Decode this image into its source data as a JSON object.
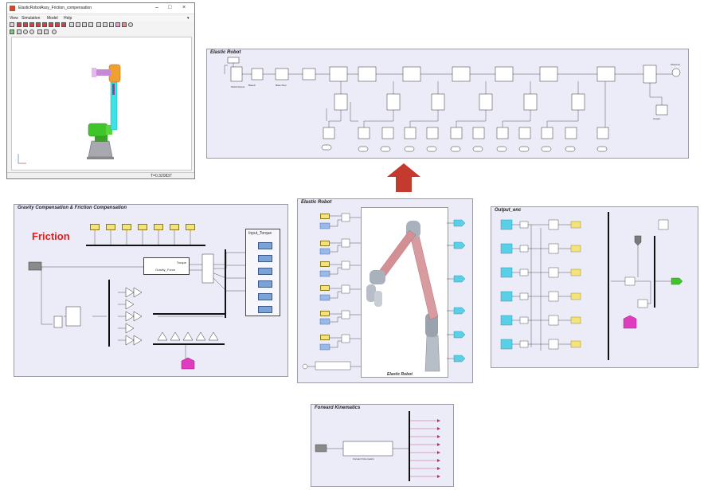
{
  "window": {
    "title": "ElasticRobotAssy_Friction_compensation",
    "menu": [
      "View",
      "Simulation",
      "Model",
      "Help"
    ],
    "status_time": "T=0.320837"
  },
  "panels": {
    "elastic_top": {
      "title": "Elastic Robot"
    },
    "gravity": {
      "title": "Gravity Compensation & Friction Compensation",
      "label": "Friction",
      "input_torque": "Input_Torque",
      "gravity_torque": "Torque",
      "gravity_force": "Gravity_Force"
    },
    "elastic_mid": {
      "title": "Elastic Robot",
      "caption": "Elastic Robot"
    },
    "output": {
      "title": "Output_enc"
    },
    "forward": {
      "title": "Forward Kinematics",
      "block_label": "Forward Kinematics"
    }
  },
  "colors": {
    "arrow": "#c0392b",
    "panel_bg": "#ecebf8",
    "friction_text": "#e02020",
    "tag_yellow": "#f4e27a",
    "tag_cyan": "#5ad0e8",
    "tag_magenta": "#e03cbf",
    "robot_green": "#3fc42a",
    "robot_cyan": "#3fe0e6"
  }
}
